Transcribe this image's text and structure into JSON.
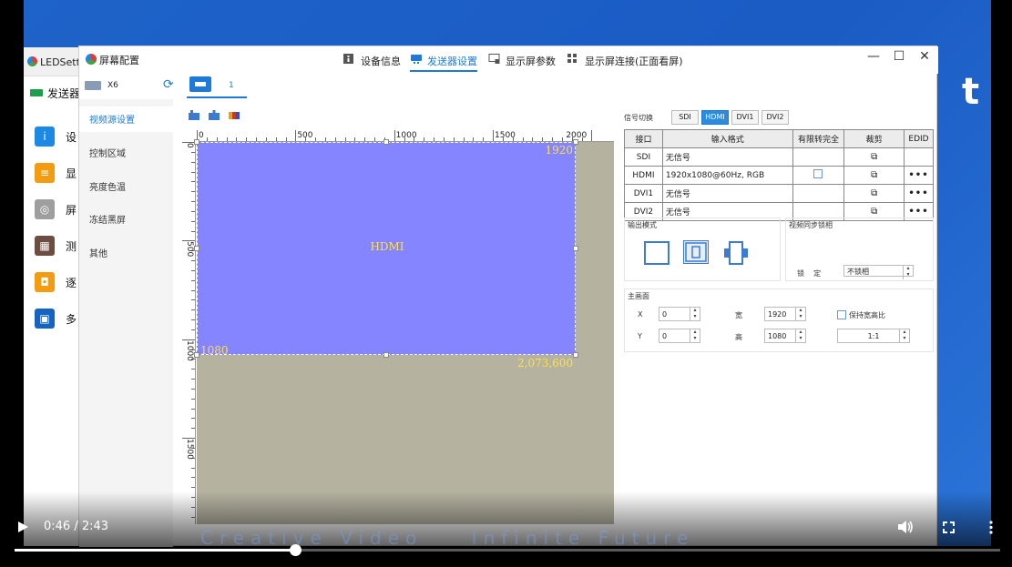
{
  "background": {
    "big_letter": "t",
    "back_window": {
      "title": "LEDSett",
      "sender_label": "发送器",
      "items": [
        {
          "label": "设",
          "color": "#1e88e5",
          "glyph": "i"
        },
        {
          "label": "显",
          "color": "#f39c12",
          "glyph": "≡"
        },
        {
          "label": "屏",
          "color": "#9e9e9e",
          "glyph": "◎"
        },
        {
          "label": "测",
          "color": "#6d4c41",
          "glyph": "▦"
        },
        {
          "label": "逐",
          "color": "#f39c12",
          "glyph": "◘"
        },
        {
          "label": "多",
          "color": "#1565c0",
          "glyph": "▣"
        }
      ]
    }
  },
  "window": {
    "title": "屏幕配置",
    "tabs": [
      "设备信息",
      "发送器设置",
      "显示屏参数",
      "显示屏连接(正面看屏)"
    ],
    "active_tab": 1,
    "controls": {
      "minimize": "—",
      "maximize": "☐",
      "close": "✕"
    }
  },
  "device": {
    "name": "X6",
    "screen_number": "1"
  },
  "sidebar": {
    "items": [
      "视频源设置",
      "控制区域",
      "亮度色温",
      "冻结黑屏",
      "其他"
    ],
    "active": 0
  },
  "ruler": {
    "h_labels": [
      "0",
      "500",
      "1000",
      "1500",
      "2000"
    ],
    "v_labels": [
      "0",
      "500",
      "1000",
      "1500"
    ]
  },
  "canvas": {
    "source_label": "HDMI",
    "width_label": "1920",
    "height_label": "1080",
    "area_label": "2,073,600",
    "source_color": "#8585ff",
    "bg_color": "#b5b2a0"
  },
  "signal": {
    "label": "信号切换",
    "buttons": [
      "SDI",
      "HDMI",
      "DVI1",
      "DVI2"
    ],
    "active": 1
  },
  "input_table": {
    "headers": [
      "接口",
      "输入格式",
      "有限转完全",
      "裁剪",
      "EDID"
    ],
    "rows": [
      {
        "port": "SDI",
        "format": "无信号",
        "limited": false,
        "crop": "⧉",
        "edid": ""
      },
      {
        "port": "HDMI",
        "format": "1920x1080@60Hz, RGB",
        "limited": true,
        "crop": "⧉",
        "edid": "•••"
      },
      {
        "port": "DVI1",
        "format": "无信号",
        "limited": false,
        "crop": "⧉",
        "edid": "•••"
      },
      {
        "port": "DVI2",
        "format": "无信号",
        "limited": false,
        "crop": "⧉",
        "edid": "•••"
      }
    ]
  },
  "output_mode": {
    "label": "输出模式"
  },
  "sync": {
    "label": "视频同步锁相",
    "lock_label": "锁    定",
    "lock_value": "不锁相"
  },
  "main_screen": {
    "label": "主画面",
    "x_label": "X",
    "x_value": "0",
    "y_label": "Y",
    "y_value": "0",
    "w_label": "宽",
    "w_value": "1920",
    "h_label": "高",
    "h_value": "1080",
    "keep_ratio": "保持宽高比",
    "ratio_btn": "1:1"
  },
  "player": {
    "time": "0:46 / 2:43",
    "progress": 0.285,
    "watermark": "Creative Video    Infinite Future"
  }
}
